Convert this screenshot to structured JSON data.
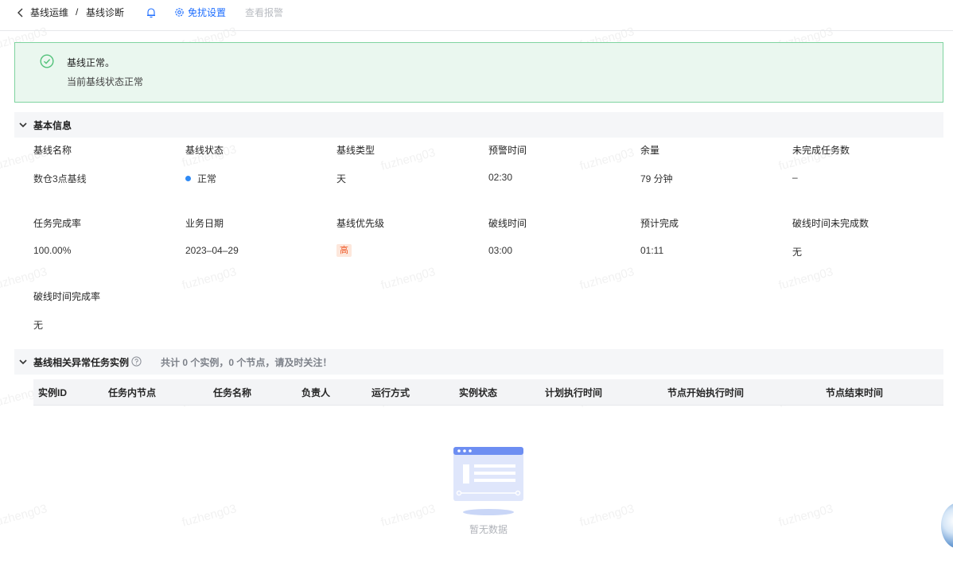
{
  "header": {
    "breadcrumb": [
      "基线运维",
      "基线诊断"
    ],
    "separator": "/",
    "exempt_settings": "免扰设置",
    "view_alerts": "查看报警"
  },
  "alert": {
    "title": "基线正常。",
    "description": "当前基线状态正常"
  },
  "basic_info": {
    "title": "基本信息",
    "fields": [
      {
        "label": "基线名称",
        "value": "数仓3点基线"
      },
      {
        "label": "基线状态",
        "value": "正常"
      },
      {
        "label": "基线类型",
        "value": "天"
      },
      {
        "label": "预警时间",
        "value": "02:30"
      },
      {
        "label": "余量",
        "value": "79 分钟"
      },
      {
        "label": "未完成任务数",
        "value": "–"
      },
      {
        "label": "任务完成率",
        "value": "100.00%"
      },
      {
        "label": "业务日期",
        "value": "2023–04–29"
      },
      {
        "label": "基线优先级",
        "value": "高"
      },
      {
        "label": "破线时间",
        "value": "03:00"
      },
      {
        "label": "预计完成",
        "value": "01:11"
      },
      {
        "label": "破线时间未完成数",
        "value": "无"
      },
      {
        "label": "破线时间完成率",
        "value": "无"
      }
    ],
    "status_color": "#2f8af5",
    "priority_color": "#ee5b2a"
  },
  "abnormal_tasks": {
    "title": "基线相关异常任务实例",
    "summary": "共计 0 个实例，0 个节点，请及时关注！",
    "columns": [
      "实例ID",
      "任务内节点",
      "任务名称",
      "负责人",
      "运行方式",
      "实例状态",
      "计划执行时间",
      "节点开始执行时间",
      "节点结束时间"
    ],
    "rows": [],
    "empty_text": "暂无数据"
  },
  "watermark": "fuzheng03",
  "icons": [
    "chevron-left-icon",
    "bell-icon",
    "gear-icon",
    "check-circle-icon",
    "chevron-down-icon",
    "help-circle-icon",
    "empty-state-illustration"
  ],
  "colors": {
    "primary": "#1b6cff",
    "success": "#52c27a",
    "alert_bg": "#eaf7ef"
  }
}
